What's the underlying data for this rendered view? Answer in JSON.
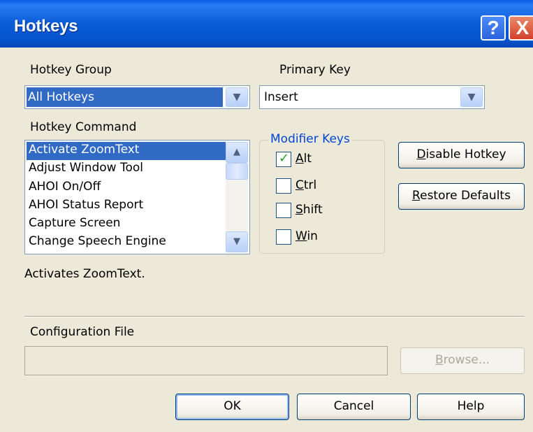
{
  "window": {
    "title": "Hotkeys",
    "help_glyph": "?",
    "close_glyph": "X"
  },
  "hotkey_group": {
    "label": "Hotkey Group",
    "selected": "All Hotkeys"
  },
  "primary_key": {
    "label": "Primary Key",
    "selected": "Insert"
  },
  "hotkey_command": {
    "label": "Hotkey Command",
    "items": [
      "Activate ZoomText",
      "Adjust Window Tool",
      "AHOI On/Off",
      "AHOI Status Report",
      "Capture Screen",
      "Change Speech Engine"
    ],
    "selected_index": 0
  },
  "modifier_keys": {
    "title": "Modifier Keys",
    "items": [
      {
        "key": "A",
        "rest": "lt",
        "checked": true
      },
      {
        "key": "C",
        "rest": "trl",
        "checked": false
      },
      {
        "key": "S",
        "rest": "hift",
        "checked": false
      },
      {
        "key": "W",
        "rest": "in",
        "checked": false
      }
    ]
  },
  "buttons": {
    "disable": {
      "key": "D",
      "rest": "isable Hotkey"
    },
    "restore": {
      "key": "R",
      "rest": "estore Defaults"
    },
    "browse": {
      "key": "B",
      "rest": "rowse..."
    },
    "ok": "OK",
    "cancel": "Cancel",
    "help": "Help"
  },
  "description": "Activates ZoomText.",
  "config": {
    "label": "Configuration File",
    "value": ""
  },
  "icons": {
    "dropdown": "chevron-down",
    "scroll_up": "chevron-up",
    "scroll_down": "chevron-down",
    "check": "checkmark"
  },
  "colors": {
    "titlebar": "#0A5AD8",
    "selection": "#316AC5",
    "group_title": "#0046D5",
    "close": "#D4402A",
    "face": "#ECE9D8"
  }
}
